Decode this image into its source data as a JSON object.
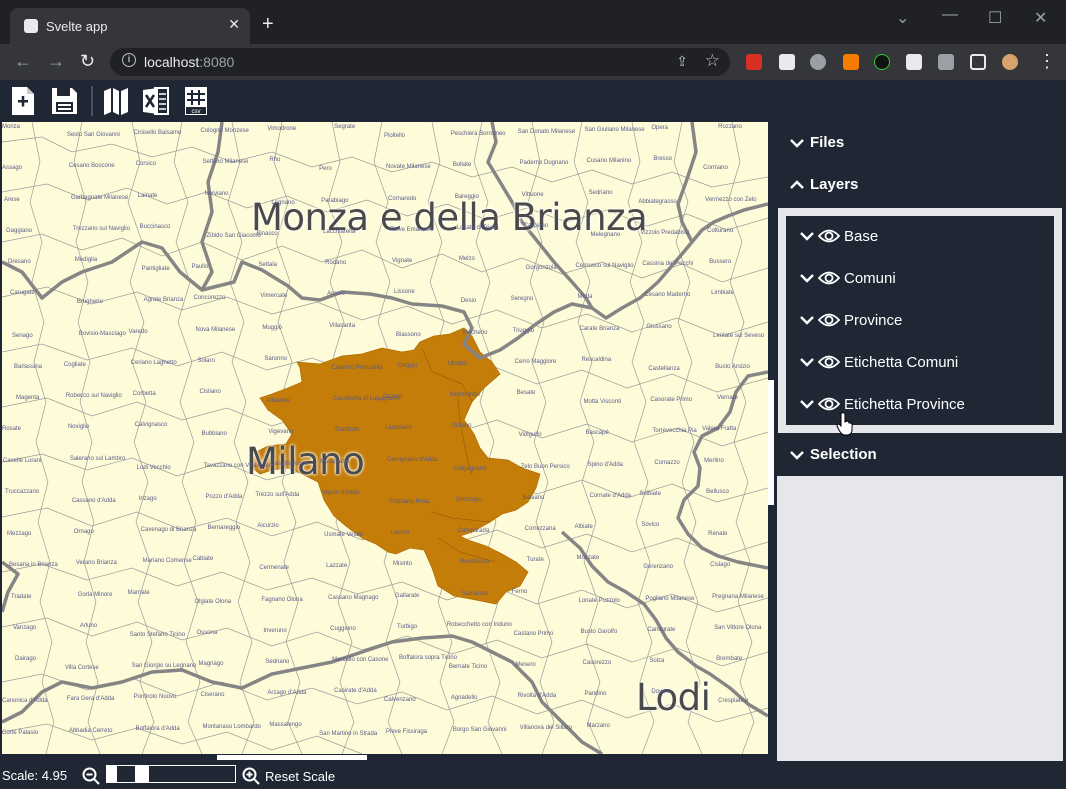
{
  "browser": {
    "tab_title": "Svelte app",
    "url_host": "localhost",
    "url_port": ":8080"
  },
  "app_toolbar": {
    "icons": [
      "new-file-icon",
      "save-icon",
      "map-icon",
      "excel-icon",
      "csv-icon"
    ],
    "csv_label": "csv"
  },
  "map": {
    "province_labels": [
      "Monza e della Brianza",
      "Milano",
      "Lodi"
    ],
    "highlighted_color": "#c47d09",
    "base_color": "#fefcd8",
    "comuni": [
      "Monza",
      "Sesto San Giovanni",
      "Cinisello Balsamo",
      "Cologno Monzese",
      "Vimodrone",
      "Segrate",
      "Pioltello",
      "Peschiera Borromeo",
      "San Donato Milanese",
      "San Giuliano Milanese",
      "Opera",
      "Rozzano",
      "Assago",
      "Cesano Boscone",
      "Corsico",
      "Settimo Milanese",
      "Rho",
      "Pero",
      "Novate Milanese",
      "Bollate",
      "Paderno Dugnano",
      "Cusano Milanino",
      "Bresso",
      "Cormano",
      "Arese",
      "Garbagnate Milanese",
      "Lainate",
      "Nerviano",
      "Legnano",
      "Parabiago",
      "Cornaredo",
      "Bareggio",
      "Vittuone",
      "Sedriano",
      "Abbiategrasso",
      "Vermezzo con Zelo",
      "Gaggiano",
      "Trezzano sul Naviglio",
      "Buccinasco",
      "Zibido San Giacomo",
      "Binasco",
      "Lacchiarella",
      "Pieve Emanuele",
      "Locate di Triulzi",
      "Carpiano",
      "Melegnano",
      "Vizzolo Predabissi",
      "Colturano",
      "Dresano",
      "Mediglia",
      "Pantigliate",
      "Paullo",
      "Settala",
      "Rodano",
      "Vignate",
      "Melzo",
      "Gorgonzola",
      "Cernusco sul Naviglio",
      "Cassina de' Pecchi",
      "Bussero",
      "Carugate",
      "Brugherio",
      "Agrate Brianza",
      "Concorezzo",
      "Vimercate",
      "Arcore",
      "Lissone",
      "Desio",
      "Seregno",
      "Meda",
      "Cesano Maderno",
      "Limbiate",
      "Senago",
      "Bovisio-Masciago",
      "Varedo",
      "Nova Milanese",
      "Muggiò",
      "Villasanta",
      "Biassono",
      "Macherio",
      "Triuggio",
      "Carate Brianza",
      "Giussano",
      "Lentate sul Seveso",
      "Barlassina",
      "Cogliate",
      "Ceriano Laghetto",
      "Solaro",
      "Saronno",
      "Caronno Pertusella",
      "Origgio",
      "Uboldo",
      "Cerro Maggiore",
      "Rescaldina",
      "Castellanza",
      "Busto Arsizio",
      "Magenta",
      "Robecco sul Naviglio",
      "Corbetta",
      "Cisliano",
      "Albairate",
      "Cassinetta di Lugagnano",
      "Ozzero",
      "Morimondo",
      "Besate",
      "Motta Visconti",
      "Casorate Primo",
      "Vernate",
      "Rosate",
      "Noviglio",
      "Calvignasco",
      "Bubbiano",
      "Vigevano",
      "Gambolò",
      "Landriano",
      "Siziano",
      "Vidigulfo",
      "Bascapè",
      "Torrevecchia Pia",
      "Valera Fratta",
      "Caselle Lurani",
      "Salerano sul Lambro",
      "Lodi Vecchio",
      "Tavazzano con Villavesco",
      "Casalmaiocco",
      "Mulazzano",
      "Cervignano d'Adda",
      "Galgagnano",
      "Zelo Buon Persico",
      "Spino d'Adda",
      "Comazzo",
      "Merlino",
      "Truccazzano",
      "Cassano d'Adda",
      "Inzago",
      "Pozzo d'Adda",
      "Trezzo sull'Adda",
      "Vaprio d'Adda",
      "Trezzano Rosa",
      "Grezzago",
      "Basiano",
      "Cornate d'Adda",
      "Sulbiate",
      "Bellusco",
      "Mezzago",
      "Ornago",
      "Cavenago di Brianza",
      "Bernareggio",
      "Aicurzio",
      "Usmate Velate",
      "Lesmo",
      "Camparada",
      "Correzzana",
      "Albiate",
      "Sovico",
      "Renate",
      "Besana in Brianza",
      "Verano Brianza",
      "Mariano Comense",
      "Cabiate",
      "Cermenate",
      "Lazzate",
      "Misinto",
      "Rovellasca",
      "Turate",
      "Mozzate",
      "Gerenzano",
      "Cislago",
      "Tradate",
      "Gorla Minore",
      "Marnate",
      "Olgiate Olona",
      "Fagnano Olona",
      "Cassano Magnago",
      "Gallarate",
      "Samarate",
      "Ferno",
      "Lonate Pozzolo",
      "Pogliano Milanese",
      "Pregnana Milanese",
      "Vanzago",
      "Arluno",
      "Santo Stefano Ticino",
      "Ossona",
      "Inveruno",
      "Cuggiono",
      "Turbigo",
      "Robecchetto con Induno",
      "Castano Primo",
      "Busto Garolfo",
      "Canegrate",
      "San Vittore Olona",
      "Dairago",
      "Villa Cortese",
      "San Giorgio su Legnano",
      "Magnago",
      "Sedriano",
      "Marcallo con Casone",
      "Boffalora sopra Ticino",
      "Bernate Ticino",
      "Mesero",
      "Casorezzo",
      "Solza",
      "Brembate",
      "Canonica d'Adda",
      "Fara Gera d'Adda",
      "Pontirolo Nuovo",
      "Ciserano",
      "Arzago d'Adda",
      "Casirate d'Adda",
      "Calvenzano",
      "Agnadello",
      "Rivolta d'Adda",
      "Pandino",
      "Dovera",
      "Crespiatica",
      "Corte Palasio",
      "Abbadia Cerreto",
      "Boffalora d'Adda",
      "Montanaso Lombardo",
      "Massalengo",
      "San Martino in Strada",
      "Pieve Fissiraga",
      "Borgo San Giovanni",
      "Villanova del Sillaro",
      "Marzano"
    ]
  },
  "panel": {
    "files_label": "Files",
    "layers_label": "Layers",
    "selection_label": "Selection",
    "layers": [
      {
        "label": "Base"
      },
      {
        "label": "Comuni"
      },
      {
        "label": "Province"
      },
      {
        "label": "Etichetta Comuni"
      },
      {
        "label": "Etichetta Province"
      }
    ]
  },
  "status": {
    "scale_text": "Scale: 4.95",
    "reset_label": "Reset Scale"
  }
}
